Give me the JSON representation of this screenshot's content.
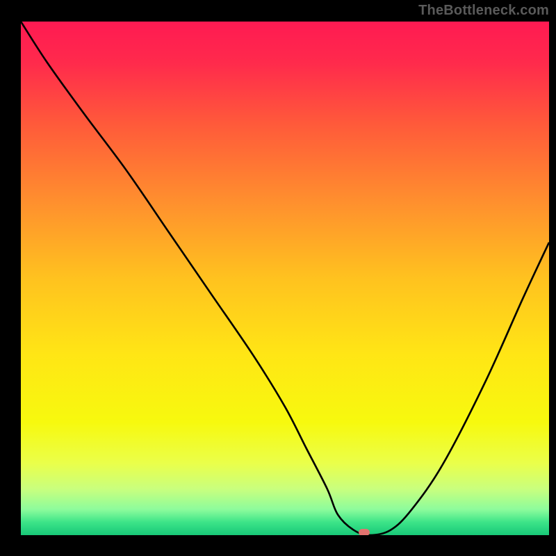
{
  "watermark": "TheBottleneck.com",
  "colors": {
    "frame_bg": "#000000",
    "curve_stroke": "#000000",
    "marker_fill": "#e2736f",
    "gradient_stops": [
      {
        "offset": 0.0,
        "color": "#ff1a52"
      },
      {
        "offset": 0.08,
        "color": "#ff2a4c"
      },
      {
        "offset": 0.2,
        "color": "#ff5a3a"
      },
      {
        "offset": 0.35,
        "color": "#ff8f2e"
      },
      {
        "offset": 0.5,
        "color": "#ffc21f"
      },
      {
        "offset": 0.65,
        "color": "#ffe615"
      },
      {
        "offset": 0.78,
        "color": "#f7f90e"
      },
      {
        "offset": 0.86,
        "color": "#eaff4a"
      },
      {
        "offset": 0.91,
        "color": "#c9ff7e"
      },
      {
        "offset": 0.95,
        "color": "#8dfc9c"
      },
      {
        "offset": 0.975,
        "color": "#3ce488"
      },
      {
        "offset": 1.0,
        "color": "#18c878"
      }
    ]
  },
  "chart_data": {
    "type": "line",
    "title": "",
    "xlabel": "",
    "ylabel": "",
    "xlim": [
      0,
      100
    ],
    "ylim": [
      0,
      100
    ],
    "series": [
      {
        "name": "bottleneck-curve",
        "x": [
          0,
          5,
          12,
          20,
          28,
          36,
          44,
          50,
          54,
          58,
          60,
          63,
          66,
          70,
          74,
          80,
          88,
          95,
          100
        ],
        "y": [
          100,
          92,
          82,
          71,
          59,
          47,
          35,
          25,
          17,
          9,
          4,
          1,
          0,
          1,
          5,
          14,
          30,
          46,
          57
        ]
      }
    ],
    "markers": [
      {
        "name": "optimal-point",
        "x": 65,
        "y": 0.5
      }
    ],
    "grid": false,
    "legend": false
  }
}
